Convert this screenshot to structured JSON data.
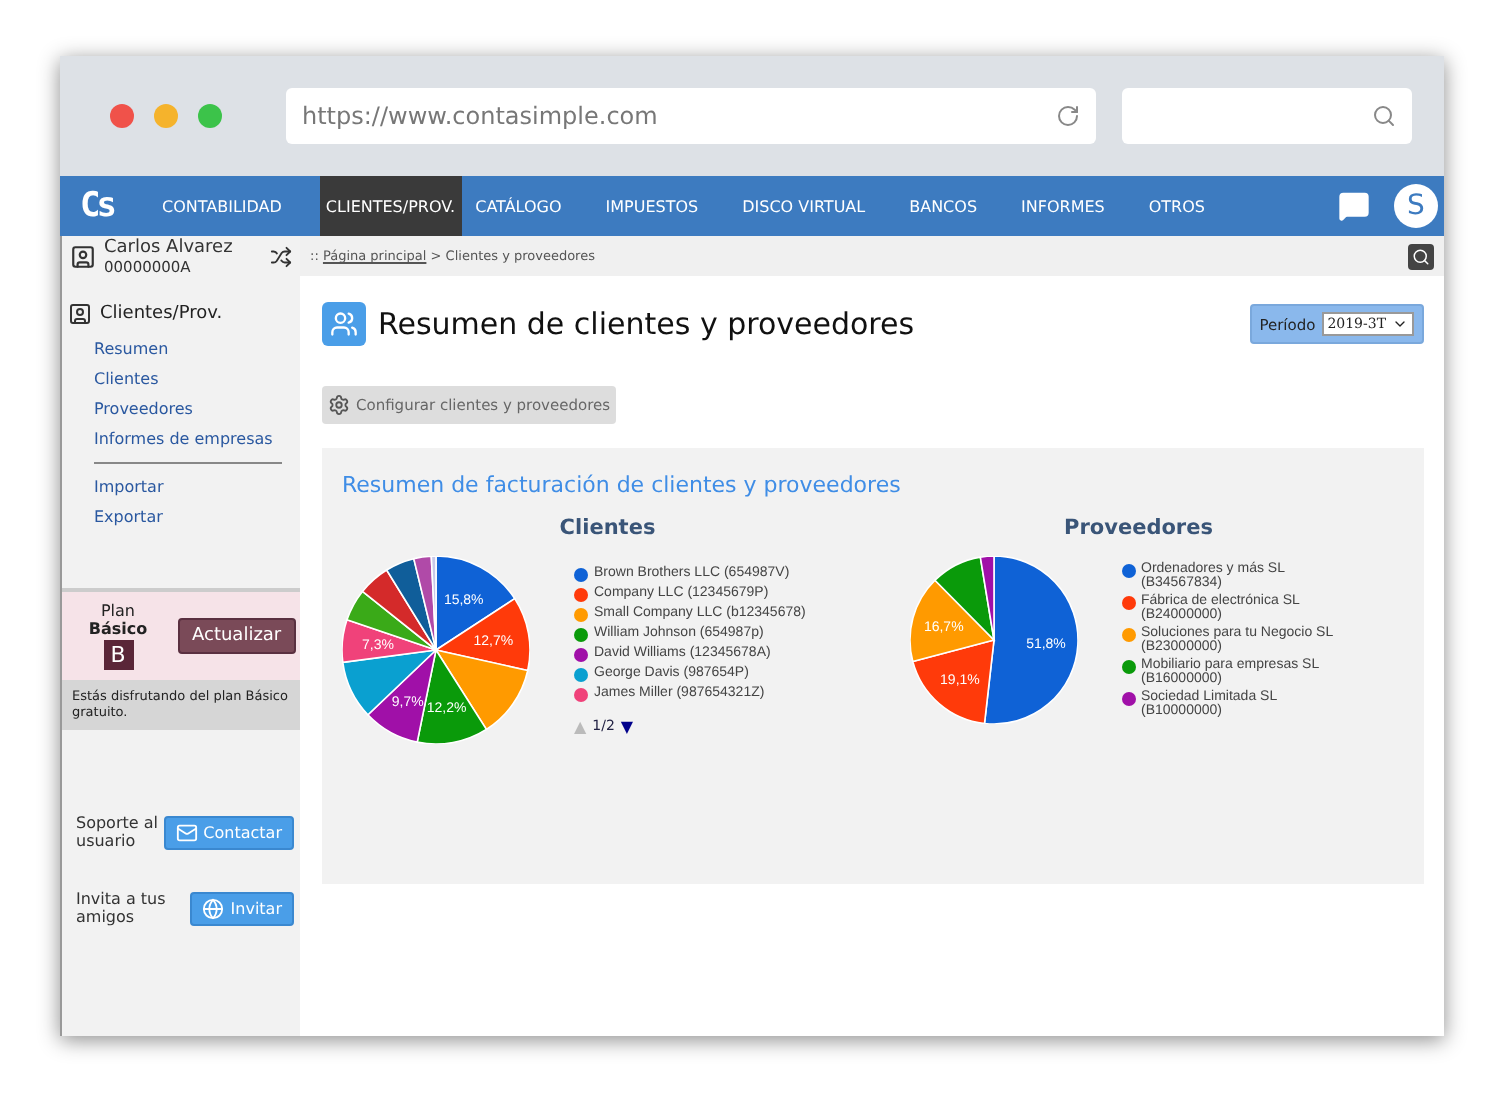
{
  "browser": {
    "url": "https://www.contasimple.com"
  },
  "nav": {
    "logo": "Cs",
    "items": [
      {
        "label": "CONTABILIDAD",
        "selected": false
      },
      {
        "label": "CLIENTES/PROV.",
        "selected": true
      },
      {
        "label": "CATÁLOGO",
        "selected": false
      },
      {
        "label": "IMPUESTOS",
        "selected": false
      },
      {
        "label": "DISCO VIRTUAL",
        "selected": false
      },
      {
        "label": "BANCOS",
        "selected": false
      },
      {
        "label": "INFORMES",
        "selected": false
      },
      {
        "label": "OTROS",
        "selected": false
      }
    ],
    "avatar": "S"
  },
  "user": {
    "name": "Carlos Alvarez",
    "id": "00000000A"
  },
  "breadcrumb": {
    "prefix": "::",
    "link": "Página principal",
    "rest": "> Clientes y proveedores"
  },
  "sidebar": {
    "section": "Clientes/Prov.",
    "groups": [
      [
        "Resumen",
        "Clientes",
        "Proveedores",
        "Informes de empresas"
      ],
      [
        "Importar",
        "Exportar"
      ]
    ],
    "plan": {
      "label": "Plan",
      "name": "Básico",
      "badge": "B",
      "button": "Actualizar",
      "note": "Estás disfrutando del plan Básico gratuito."
    },
    "support": {
      "text": "Soporte al usuario",
      "button": "Contactar"
    },
    "invite": {
      "text": "Invita a tus amigos",
      "button": "Invitar"
    }
  },
  "page": {
    "title": "Resumen de clientes y proveedores",
    "period_label": "Período",
    "period_value": "2019-3T",
    "config_button": "Configurar clientes y proveedores"
  },
  "summary": {
    "title": "Resumen de facturación de clientes y proveedores",
    "charts": [
      {
        "chart_data": {
          "type": "pie",
          "title": "Clientes",
          "series": [
            {
              "values": [
                15.8,
                12.7,
                12.5,
                12.2,
                9.7,
                10,
                7.3,
                5.5,
                5.5,
                5,
                3,
                0.8
              ]
            }
          ],
          "colors": [
            "#0f62d6",
            "#ff3a0a",
            "#ff9a00",
            "#0a9a0a",
            "#a010a8",
            "#0aa0d0",
            "#f0427a",
            "#3aaa18",
            "#d42a2a",
            "#105e9a",
            "#b04aa8",
            "#c8c8e8"
          ],
          "value_labels": [
            "15,8%",
            "12,7%",
            null,
            "12,2%",
            "9,7%",
            null,
            "7,3%",
            null,
            null,
            null,
            null,
            null
          ]
        },
        "legend": [
          {
            "label": "Brown Brothers LLC (654987V)",
            "color": "#0f62d6"
          },
          {
            "label": "Company LLC (12345679P)",
            "color": "#ff3a0a"
          },
          {
            "label": "Small Company LLC (b12345678)",
            "color": "#ff9a00"
          },
          {
            "label": "William Johnson (654987p)",
            "color": "#0a9a0a"
          },
          {
            "label": "David Williams (12345678A)",
            "color": "#a010a8"
          },
          {
            "label": "George Davis (987654P)",
            "color": "#0aa0d0"
          },
          {
            "label": "James Miller (987654321Z)",
            "color": "#f0427a"
          }
        ],
        "pager": {
          "prev": "▲",
          "prev_disabled": true,
          "page": "1/2",
          "next": "▼",
          "next_disabled": false
        }
      },
      {
        "chart_data": {
          "type": "pie",
          "title": "Proveedores",
          "series": [
            {
              "values": [
                51.8,
                19.1,
                16.7,
                9.8,
                2.6
              ]
            }
          ],
          "colors": [
            "#0f62d6",
            "#ff3a0a",
            "#ff9a00",
            "#0a9a0a",
            "#a010a8"
          ],
          "value_labels": [
            "51,8%",
            "19,1%",
            "16,7%",
            null,
            null
          ]
        },
        "legend": [
          {
            "label": "Ordenadores y más SL (B34567834)",
            "color": "#0f62d6"
          },
          {
            "label": "Fábrica de electrónica SL (B24000000)",
            "color": "#ff3a0a"
          },
          {
            "label": "Soluciones para tu Negocio SL (B23000000)",
            "color": "#ff9a00"
          },
          {
            "label": "Mobiliario para empresas SL (B16000000)",
            "color": "#0a9a0a"
          },
          {
            "label": "Sociedad Limitada SL (B10000000)",
            "color": "#a010a8"
          }
        ]
      }
    ]
  }
}
